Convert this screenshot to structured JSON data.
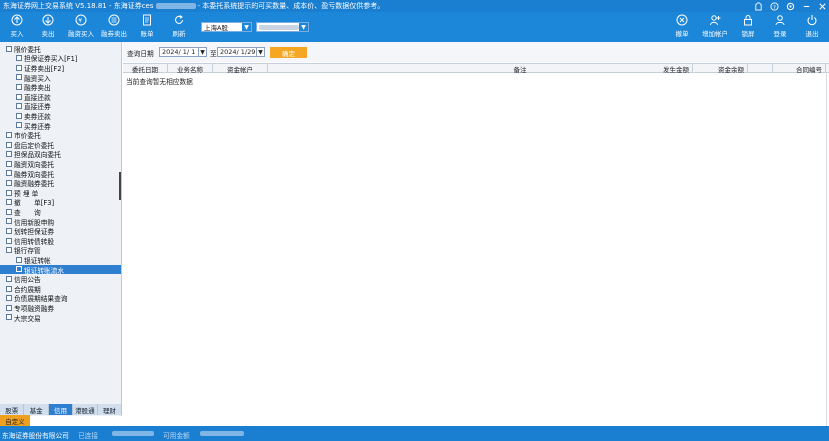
{
  "window": {
    "title_prefix": "东海证券网上交易系统 V5.18.81 - 东海证券ces",
    "title_suffix": "- 本委托系统提示的可买数量、成本价、盈亏数据仅供参考。"
  },
  "toolbar": {
    "buy": "买入",
    "sell": "卖出",
    "margin_buy": "融资买入",
    "short_sell": "融券卖出",
    "bill": "账单",
    "refresh": "刷新",
    "market_select": "上海A股",
    "account_select": "",
    "cancel_order": "撤单",
    "add_account": "增加帐户",
    "lock": "锁屏",
    "login": "登录",
    "exit": "退出"
  },
  "sidebar": {
    "items": [
      {
        "label": "限价委托",
        "indent": 0
      },
      {
        "label": "担保证券买入[F1]",
        "indent": 1
      },
      {
        "label": "证券卖出[F2]",
        "indent": 1
      },
      {
        "label": "融资买入",
        "indent": 1
      },
      {
        "label": "融券卖出",
        "indent": 1
      },
      {
        "label": "直接还款",
        "indent": 1
      },
      {
        "label": "直接还券",
        "indent": 1
      },
      {
        "label": "卖券还款",
        "indent": 1
      },
      {
        "label": "买券还券",
        "indent": 1
      },
      {
        "label": "市价委托",
        "indent": 0
      },
      {
        "label": "盘后定价委托",
        "indent": 0
      },
      {
        "label": "担保品双向委托",
        "indent": 0
      },
      {
        "label": "融资双向委托",
        "indent": 0
      },
      {
        "label": "融券双向委托",
        "indent": 0
      },
      {
        "label": "融资融券委托",
        "indent": 0
      },
      {
        "label": "预 埋 单",
        "indent": 0
      },
      {
        "label": "撤　　单[F3]",
        "indent": 0
      },
      {
        "label": "查　　询",
        "indent": 0
      },
      {
        "label": "信用新股申购",
        "indent": 0
      },
      {
        "label": "划转担保证券",
        "indent": 0
      },
      {
        "label": "信用转债转股",
        "indent": 0
      },
      {
        "label": "银行存管",
        "indent": 0
      },
      {
        "label": "银证转帐",
        "indent": 1
      },
      {
        "label": "银证转账流水",
        "indent": 1
      },
      {
        "label": "信用公告",
        "indent": 0
      },
      {
        "label": "合约展期",
        "indent": 0
      },
      {
        "label": "负债展期结果查询",
        "indent": 0
      },
      {
        "label": "专项融资融券",
        "indent": 0
      },
      {
        "label": "大宗交易",
        "indent": 0
      }
    ],
    "selected_index": 23,
    "bottom_tabs": [
      "股票",
      "基金",
      "信用",
      "港股通",
      "理财"
    ],
    "active_tab": "信用",
    "custom_tab": "自定义"
  },
  "query": {
    "date_label": "查询日期",
    "start_date": "2024/ 1/ 1",
    "to_label": "至",
    "end_date": "2024/ 1/29",
    "confirm": "确定"
  },
  "table": {
    "columns": [
      "委托日期",
      "业务名称",
      "资金帐户",
      "备注",
      "发生金额",
      "资金余额",
      "合同编号"
    ],
    "empty_message": "当前查询暂无相应数据"
  },
  "statusbar": {
    "company": "东海证券股份有限公司",
    "label_1": "已连接",
    "label_2": "可用金额"
  }
}
